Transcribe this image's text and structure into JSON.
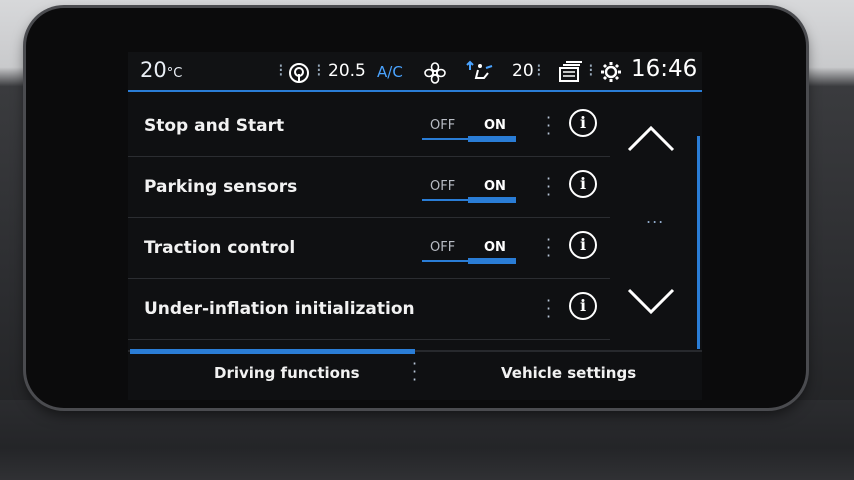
{
  "status_bar": {
    "temperature_left": "20",
    "temperature_left_unit": "°C",
    "fan_value": "20.5",
    "ac_label": "A/C",
    "airflow_value": "20",
    "clock": "16:46",
    "icons": [
      "radio-signal-icon",
      "fan-icon",
      "air-distribution-icon",
      "menu-cards-icon",
      "gear-icon"
    ]
  },
  "settings": [
    {
      "label": "Stop and Start",
      "off_label": "OFF",
      "on_label": "ON",
      "state": "ON"
    },
    {
      "label": "Parking sensors",
      "off_label": "OFF",
      "on_label": "ON",
      "state": "ON"
    },
    {
      "label": "Traction control",
      "off_label": "OFF",
      "on_label": "ON",
      "state": "ON"
    },
    {
      "label": "Under-inflation initialization"
    }
  ],
  "scroll": {
    "ellipsis": "..."
  },
  "tabs": {
    "driving_functions": "Driving functions",
    "vehicle_settings": "Vehicle settings",
    "active": "Driving functions"
  },
  "colors": {
    "accent": "#2a7dd6",
    "screen_bg": "#0f1012",
    "text": "#f2f2f2"
  }
}
